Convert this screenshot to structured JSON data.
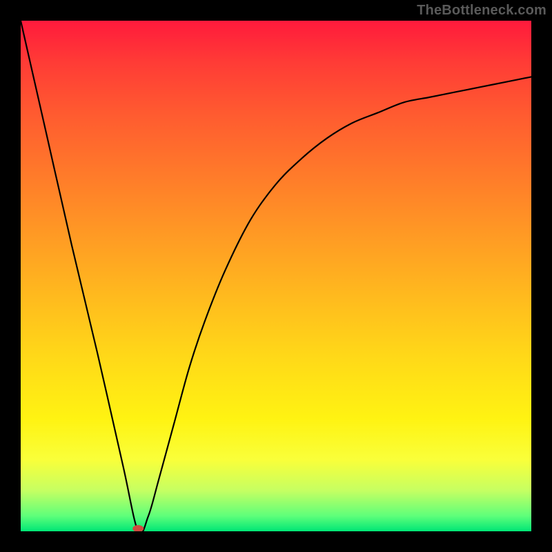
{
  "attribution": "TheBottleneck.com",
  "colors": {
    "frame_bg": "#000000",
    "gradient_top": "#ff1a3c",
    "gradient_mid1": "#ff9a24",
    "gradient_mid2": "#fff312",
    "gradient_bottom": "#00e676",
    "curve_stroke": "#000000",
    "marker_fill": "#d04a3f"
  },
  "chart_data": {
    "type": "line",
    "title": "",
    "xlabel": "",
    "ylabel": "",
    "xlim": [
      0,
      100
    ],
    "ylim": [
      0,
      100
    ],
    "grid": false,
    "legend": false,
    "series": [
      {
        "name": "curve",
        "x": [
          0,
          5,
          10,
          15,
          20,
          23,
          25,
          27,
          30,
          33,
          36,
          40,
          45,
          50,
          55,
          60,
          65,
          70,
          75,
          80,
          85,
          90,
          95,
          100
        ],
        "y": [
          100,
          78,
          56,
          35,
          13,
          0,
          3,
          10,
          21,
          32,
          41,
          51,
          61,
          68,
          73,
          77,
          80,
          82,
          84,
          85,
          86,
          87,
          88,
          89
        ]
      }
    ],
    "marker": {
      "x": 23,
      "y": 0,
      "shape": "oval",
      "color": "#d04a3f"
    },
    "notes": "V-shaped curve on a vertical red→green gradient; minimum near x≈23. y values estimated from gradient position (0 at bottom/green, 100 at top/red)."
  }
}
